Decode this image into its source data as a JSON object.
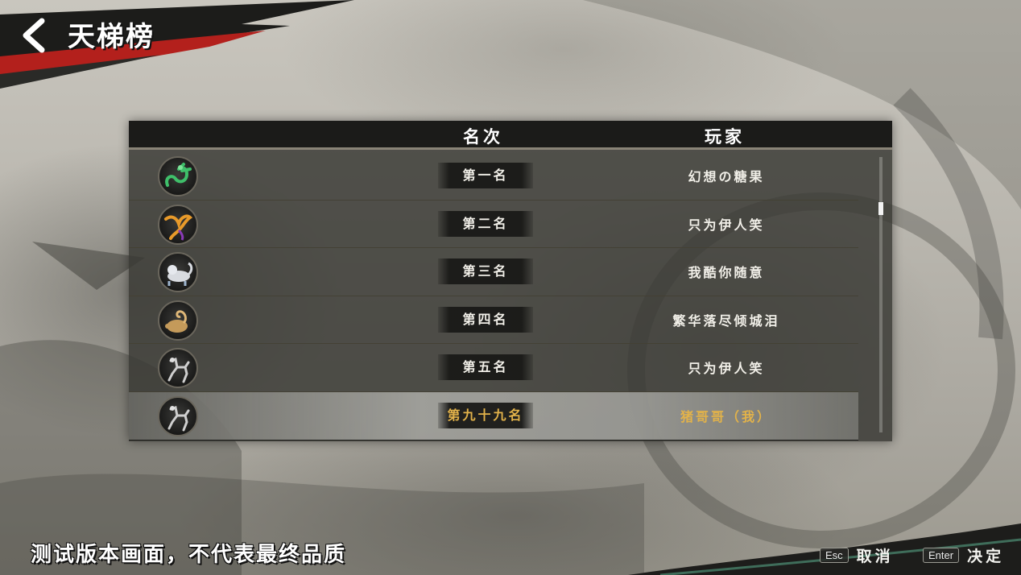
{
  "header": {
    "title": "天梯榜",
    "back_icon": "chevron-left-icon"
  },
  "table": {
    "columns": {
      "rank": "名次",
      "player": "玩家"
    },
    "rows": [
      {
        "avatar": "green-dragon-icon",
        "rank": "第一名",
        "player": "幻想の糖果",
        "is_self": false
      },
      {
        "avatar": "vermilion-bird-icon",
        "rank": "第二名",
        "player": "只为伊人笑",
        "is_self": false
      },
      {
        "avatar": "white-tiger-icon",
        "rank": "第三名",
        "player": "我酷你随意",
        "is_self": false
      },
      {
        "avatar": "black-tortoise-icon",
        "rank": "第四名",
        "player": "繁华落尽倾城泪",
        "is_self": false
      },
      {
        "avatar": "silver-horse-icon",
        "rank": "第五名",
        "player": "只为伊人笑",
        "is_self": false
      },
      {
        "avatar": "silver-horse-icon",
        "rank": "第九十九名",
        "player": "猪哥哥（我）",
        "is_self": true
      }
    ],
    "highlight_color": "#e2b24a"
  },
  "footer": {
    "disclaimer": "测试版本画面，不代表最终品质",
    "hints": [
      {
        "key": "Esc",
        "label": "取消"
      },
      {
        "key": "Enter",
        "label": "决定"
      }
    ]
  }
}
